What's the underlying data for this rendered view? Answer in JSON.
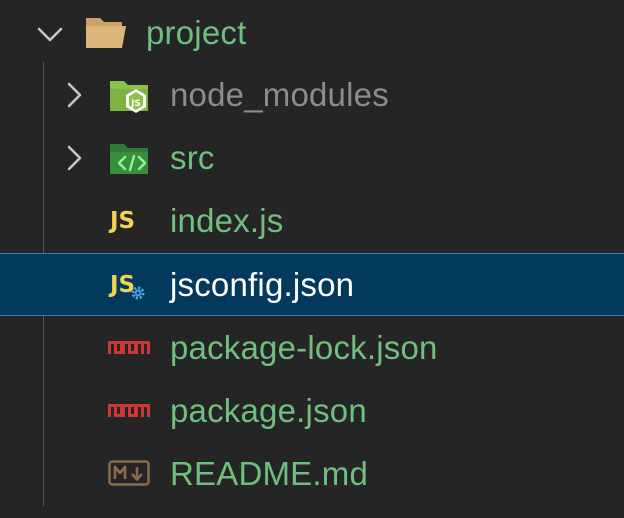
{
  "tree": {
    "root": {
      "label": "project",
      "expanded": true,
      "icon": "folder-open-icon",
      "color": "#6fbf7d"
    },
    "items": [
      {
        "label": "node_modules",
        "kind": "folder",
        "icon": "folder-nodejs-icon",
        "color": "#8c8c8c",
        "collapsed": true
      },
      {
        "label": "src",
        "kind": "folder",
        "icon": "folder-src-icon",
        "color": "#6fbf7d",
        "collapsed": true
      },
      {
        "label": "index.js",
        "kind": "file",
        "icon": "javascript-icon",
        "color": "#6fbf7d"
      },
      {
        "label": "jsconfig.json",
        "kind": "file",
        "icon": "jsconfig-icon",
        "color": "#ffffff",
        "selected": true
      },
      {
        "label": "package-lock.json",
        "kind": "file",
        "icon": "npm-icon",
        "color": "#6fbf7d"
      },
      {
        "label": "package.json",
        "kind": "file",
        "icon": "npm-icon",
        "color": "#6fbf7d"
      },
      {
        "label": "README.md",
        "kind": "file",
        "icon": "markdown-icon",
        "color": "#6fbf7d"
      }
    ],
    "js_badge": "JS",
    "colors": {
      "background": "#252526",
      "selected_background": "#04395e",
      "selected_border": "#2f7fd0",
      "chevron": "#c5c5c5",
      "js_yellow": "#f0d44f",
      "npm_red": "#cb3837",
      "markdown_brown": "#8a6a4d"
    }
  }
}
